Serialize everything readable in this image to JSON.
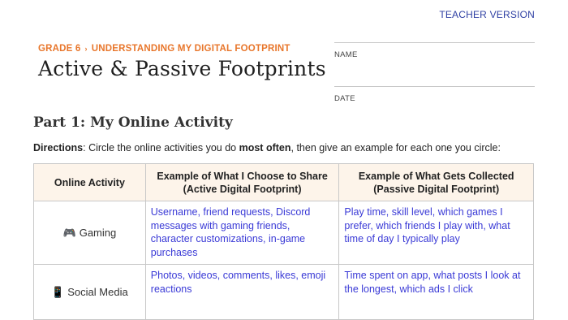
{
  "teacher_version": "TEACHER VERSION",
  "header": {
    "grade": "GRADE 6",
    "separator": "›",
    "unit": "UNDERSTANDING MY DIGITAL FOOTPRINT",
    "title": "Active & Passive Footprints"
  },
  "fields": {
    "name_label": "NAME",
    "date_label": "DATE"
  },
  "part": {
    "title": "Part 1: My Online Activity"
  },
  "directions": {
    "label": "Directions",
    "text_1": ": Circle the online activities you do ",
    "emphasis": "most often",
    "text_2": ", then give an example for each one you circle:"
  },
  "table": {
    "headers": {
      "col1": "Online Activity",
      "col2_line1": "Example of What I Choose to Share",
      "col2_line2": "(Active Digital Footprint)",
      "col3_line1": "Example of What Gets Collected",
      "col3_line2": "(Passive Digital Footprint)"
    },
    "rows": [
      {
        "icon": "🎮",
        "icon_name": "gamepad-icon",
        "activity": "Gaming",
        "active": "Username, friend requests, Discord messages with gaming friends, character customizations, in-game purchases",
        "passive": "Play time, skill level, which games I prefer, which friends I play with, what time of day I typically play"
      },
      {
        "icon": "📱",
        "icon_name": "phone-icon",
        "activity": "Social Media",
        "active": "Photos, videos, comments, likes, emoji reactions",
        "passive": "Time spent on app, what posts I look at the longest, which ads I click"
      }
    ]
  },
  "colors": {
    "accent_orange": "#e8762b",
    "answer_blue": "#3a3ad6",
    "header_bg": "#fdf4ea",
    "teacher_blue": "#2e3fa3"
  }
}
